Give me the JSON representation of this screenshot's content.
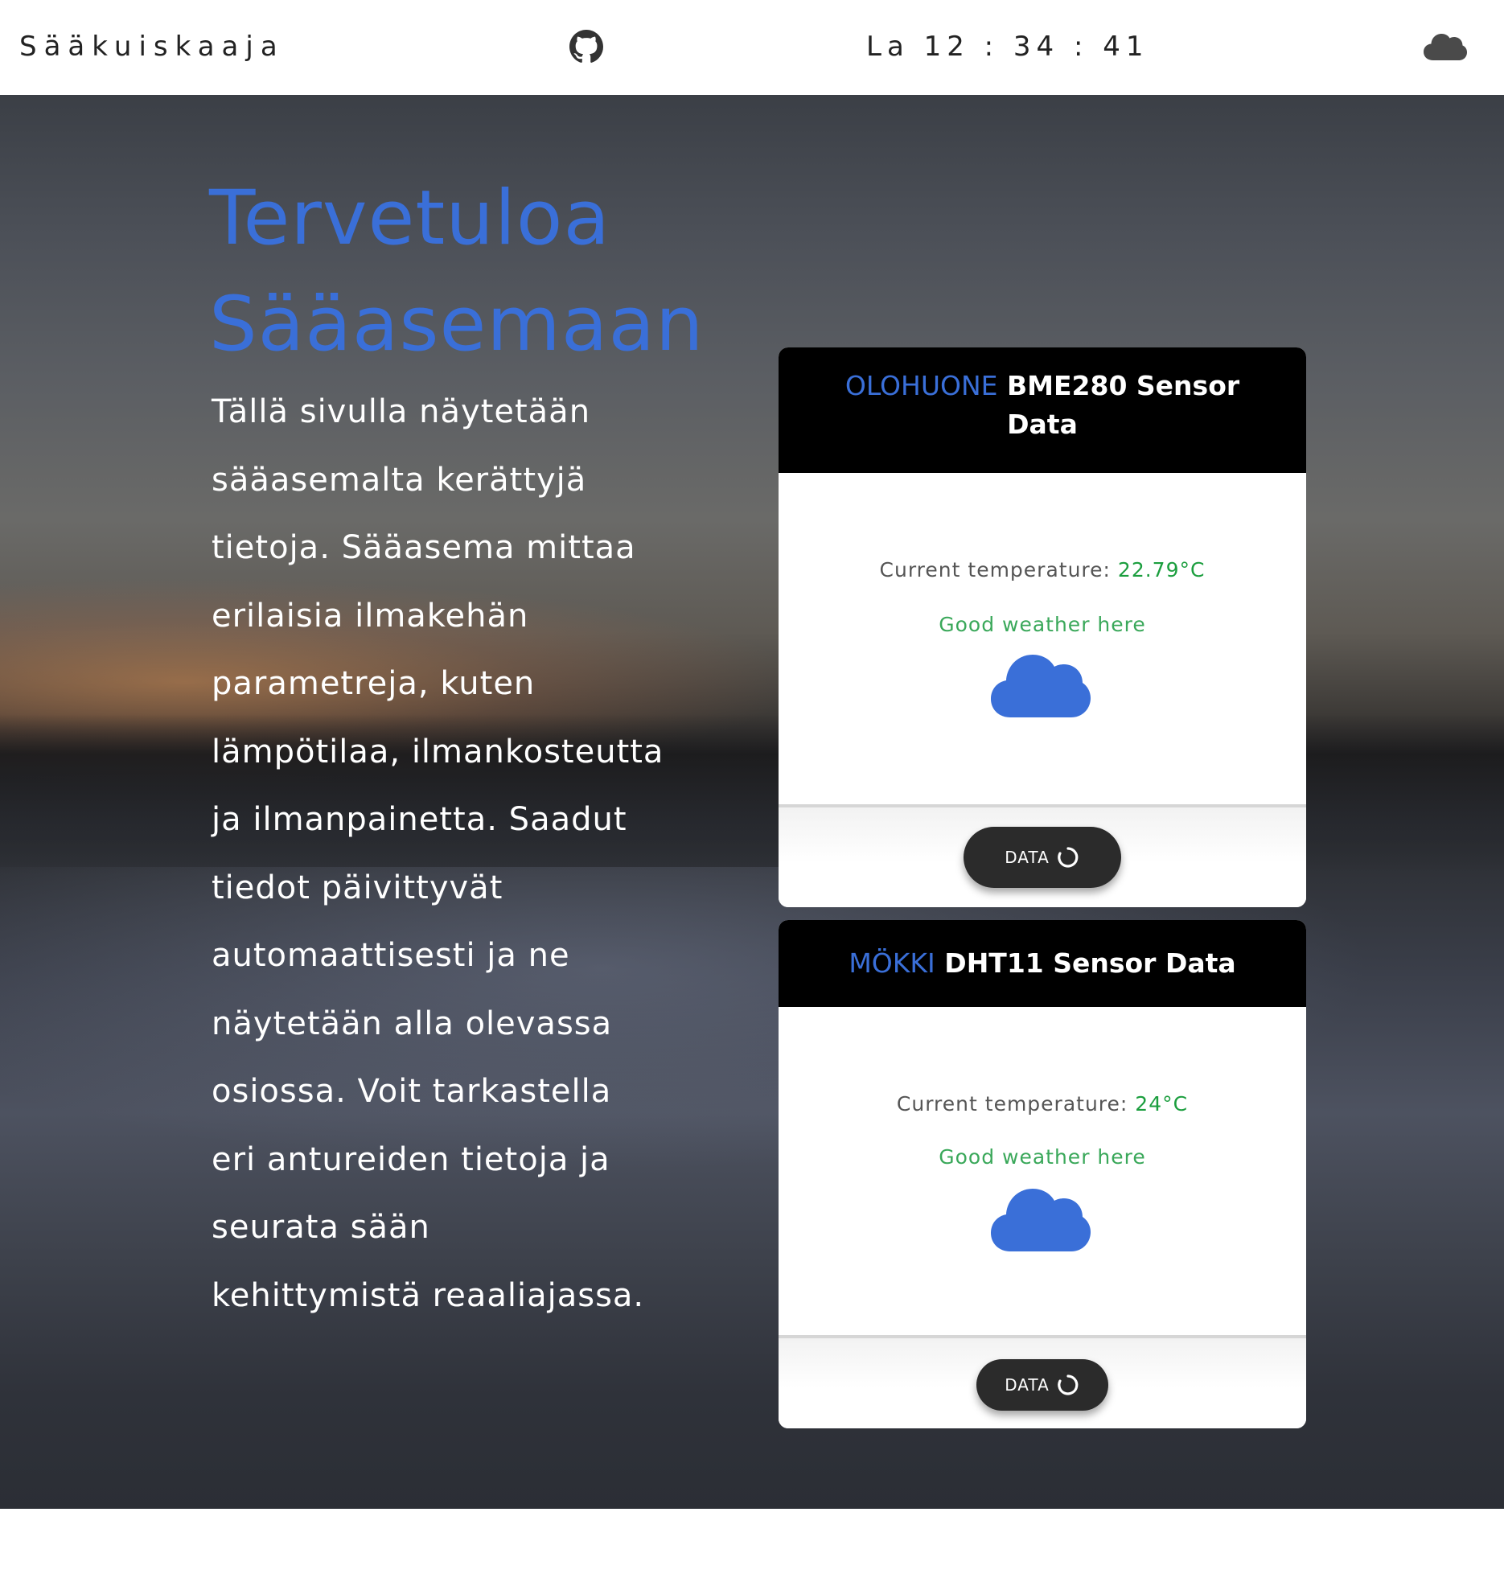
{
  "navbar": {
    "brand": "Sääkuiskaaja",
    "clock": "La 12 : 34 : 41",
    "github_icon": "github-icon",
    "weather_icon": "cloud-icon"
  },
  "hero": {
    "title_lines": [
      "Tervetuloa",
      "Sääasemaan"
    ],
    "text_lines": [
      "Tällä sivulla näytetään",
      "sääasemalta kerättyjä",
      "tietoja. Sääasema mittaa",
      "erilaisia ilmakehän",
      "parametreja, kuten",
      "lämpötilaa, ilmankosteutta",
      "ja ilmanpainetta. Saadut",
      "tiedot päivittyvät",
      "automaattisesti ja ne",
      "näytetään alla olevassa",
      "osiossa. Voit tarkastella",
      "eri antureiden tietoja ja",
      "seurata sään",
      "kehittymistä reaaliajassa."
    ]
  },
  "cards": [
    {
      "location": "OLOHUONE",
      "title_line1": "BME280 Sensor",
      "title_line2": "Data",
      "temp_label": "Current temperature:",
      "temp_value": "22.79°C",
      "status": "Good weather here",
      "icon": "cloud-icon",
      "button_label": "DATA"
    },
    {
      "location": "MÖKKI",
      "title": "DHT11 Sensor Data",
      "temp_label": "Current temperature:",
      "temp_value": "24°C",
      "status": "Good weather here",
      "icon": "cloud-icon",
      "button_label": "DATA"
    }
  ],
  "colors": {
    "accent_blue": "#3a6fd8",
    "temp_green": "#1b9e3e",
    "status_green": "#3aa85a",
    "header_black": "#000000",
    "button_dark": "#2b2b2b"
  }
}
